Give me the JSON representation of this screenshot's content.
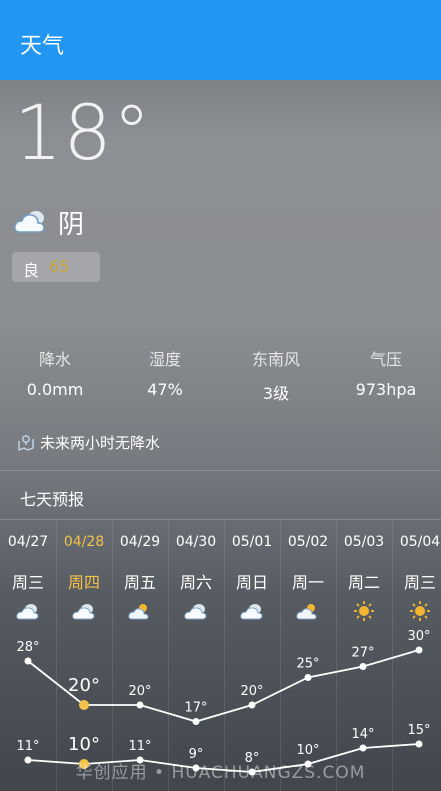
{
  "appbar": {
    "title": "天气"
  },
  "current": {
    "temperature": "18°",
    "condition": "阴",
    "condition_icon": "cloudy-icon"
  },
  "aqi": {
    "label": "良",
    "value": "65"
  },
  "stats": [
    {
      "label": "降水",
      "value": "0.0mm"
    },
    {
      "label": "湿度",
      "value": "47%"
    },
    {
      "label": "东南风",
      "value": "3级"
    },
    {
      "label": "气压",
      "value": "973hpa"
    }
  ],
  "notice": {
    "text": "未来两小时无降水"
  },
  "forecast": {
    "title": "七天预报",
    "days": [
      {
        "date": "04/27",
        "weekday": "周三",
        "icon": "cloudy-icon",
        "high": "28°",
        "low": "11°"
      },
      {
        "date": "04/28",
        "weekday": "周四",
        "icon": "cloudy-icon",
        "high": "20°",
        "low": "10°"
      },
      {
        "date": "04/29",
        "weekday": "周五",
        "icon": "partly-sunny-icon",
        "high": "20°",
        "low": "11°"
      },
      {
        "date": "04/30",
        "weekday": "周六",
        "icon": "cloudy-icon",
        "high": "17°",
        "low": "9°"
      },
      {
        "date": "05/01",
        "weekday": "周日",
        "icon": "cloudy-icon",
        "high": "20°",
        "low": "8°"
      },
      {
        "date": "05/02",
        "weekday": "周一",
        "icon": "partly-sunny-icon",
        "high": "25°",
        "low": "10°"
      },
      {
        "date": "05/03",
        "weekday": "周二",
        "icon": "sunny-icon",
        "high": "27°",
        "low": "14°"
      },
      {
        "date": "05/04",
        "weekday": "周三",
        "icon": "sunny-icon",
        "high": "30°",
        "low": "15°"
      }
    ],
    "active_index": 1,
    "highs": [
      28,
      20,
      20,
      17,
      20,
      25,
      27,
      30
    ],
    "lows": [
      11,
      10,
      11,
      9,
      8,
      10,
      14,
      15
    ],
    "highlight_color": "#f5c24a"
  },
  "watermark": "华创应用 • HUACHUANGZS.COM"
}
